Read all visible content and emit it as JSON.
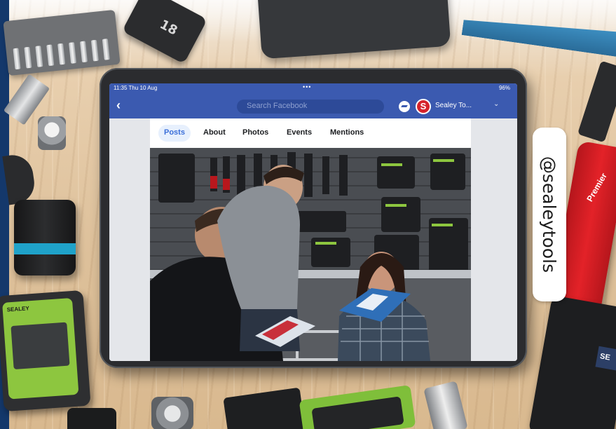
{
  "tablet": {
    "status": {
      "time": "11:35  Thu 10 Aug",
      "dots": "•••",
      "battery": "96%"
    },
    "header": {
      "back_icon": "chevron-left-icon",
      "search_placeholder": "Search Facebook",
      "messenger_icon": "messenger-icon",
      "page_avatar_letter": "S",
      "page_name": "Sealey To...",
      "chevron": "⌄"
    },
    "tabs": [
      {
        "label": "Posts",
        "active": true
      },
      {
        "label": "About",
        "active": false
      },
      {
        "label": "Photos",
        "active": false
      },
      {
        "label": "Events",
        "active": false
      },
      {
        "label": "Mentions",
        "active": false
      }
    ]
  },
  "social_handle": "@sealeytools",
  "tools": {
    "socket_label": "18",
    "inclinometer_brand": "SEALEY",
    "knife_brand": "Premier"
  },
  "colors": {
    "facebook_blue": "#3b5ab0",
    "sealey_red": "#d6232b",
    "strip_navy": "#14386b"
  }
}
